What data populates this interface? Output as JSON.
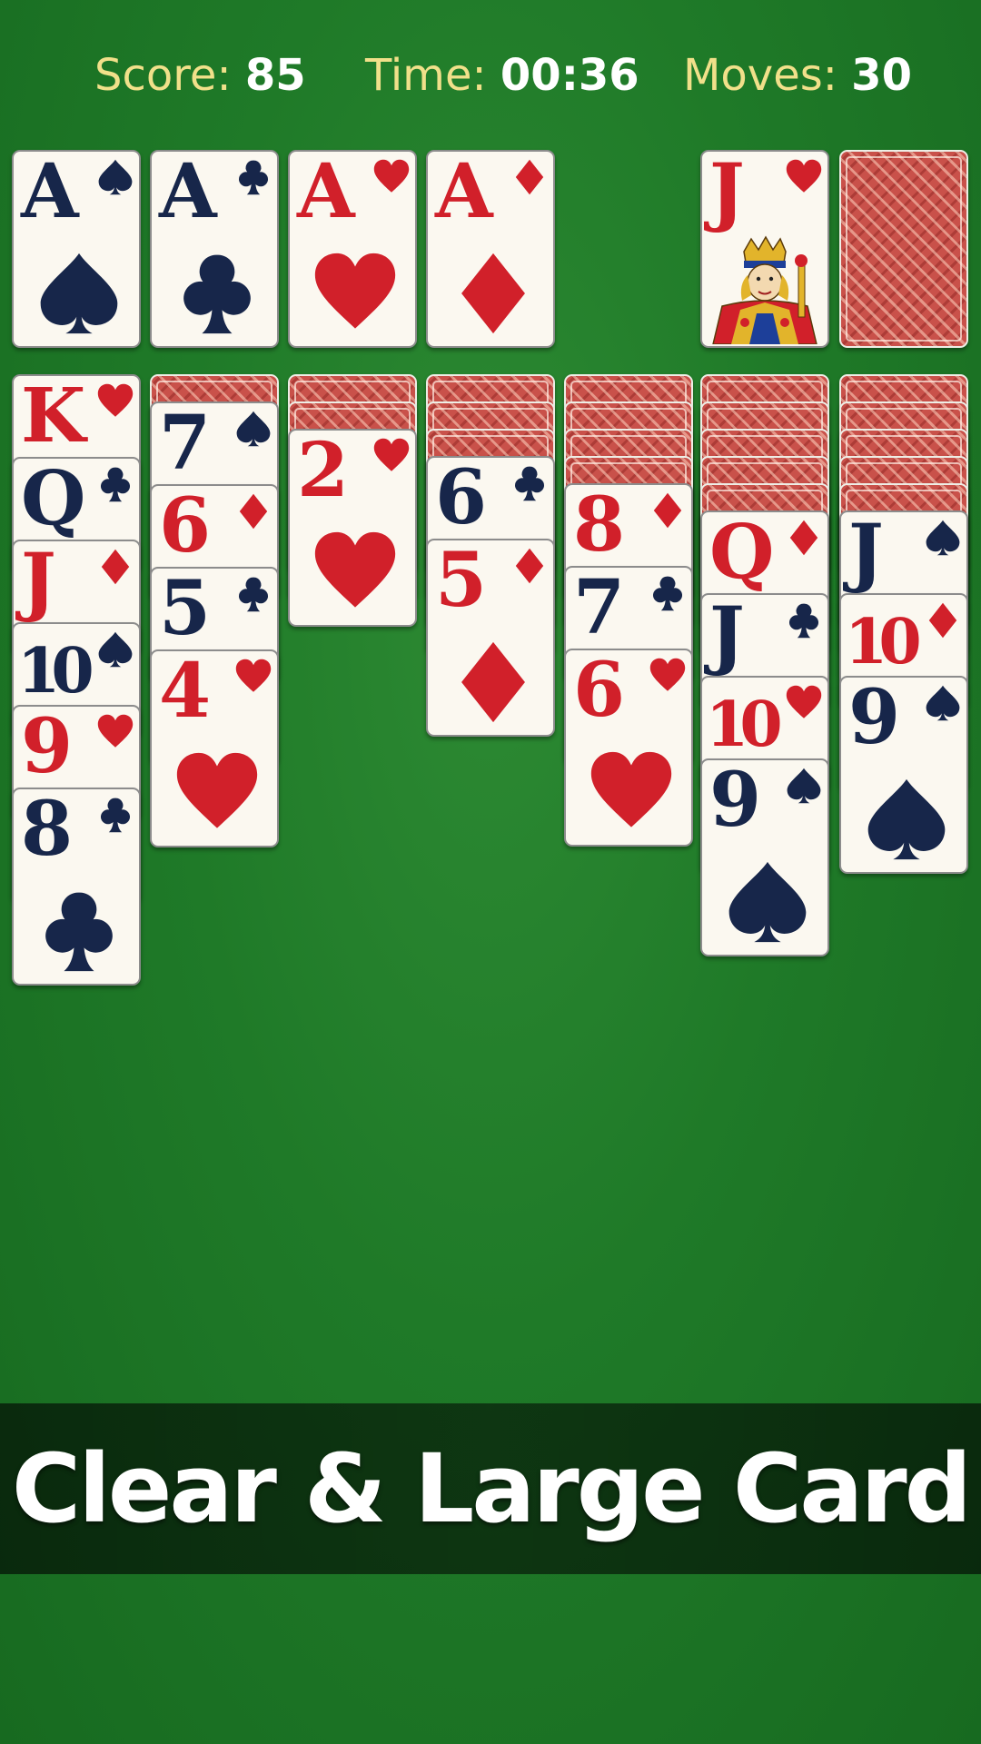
{
  "stats": {
    "score_label": "Score:",
    "score_value": "85",
    "time_label": "Time:",
    "time_value": "00:36",
    "moves_label": "Moves:",
    "moves_value": "30"
  },
  "foundations": [
    {
      "rank": "A",
      "suit": "spades"
    },
    {
      "rank": "A",
      "suit": "clubs"
    },
    {
      "rank": "A",
      "suit": "hearts"
    },
    {
      "rank": "A",
      "suit": "diamonds"
    }
  ],
  "waste": {
    "rank": "J",
    "suit": "hearts",
    "face_icon": "jack-face-icon"
  },
  "stock": {
    "face_down": true
  },
  "tableau": [
    {
      "hidden": 0,
      "cards": [
        {
          "rank": "K",
          "suit": "hearts"
        },
        {
          "rank": "Q",
          "suit": "clubs"
        },
        {
          "rank": "J",
          "suit": "diamonds"
        },
        {
          "rank": "10",
          "suit": "spades"
        },
        {
          "rank": "9",
          "suit": "hearts"
        },
        {
          "rank": "8",
          "suit": "clubs"
        }
      ]
    },
    {
      "hidden": 1,
      "cards": [
        {
          "rank": "7",
          "suit": "spades"
        },
        {
          "rank": "6",
          "suit": "diamonds"
        },
        {
          "rank": "5",
          "suit": "clubs"
        },
        {
          "rank": "4",
          "suit": "hearts"
        }
      ]
    },
    {
      "hidden": 2,
      "cards": [
        {
          "rank": "2",
          "suit": "hearts"
        }
      ]
    },
    {
      "hidden": 3,
      "cards": [
        {
          "rank": "6",
          "suit": "clubs"
        },
        {
          "rank": "5",
          "suit": "diamonds"
        }
      ]
    },
    {
      "hidden": 4,
      "cards": [
        {
          "rank": "8",
          "suit": "diamonds"
        },
        {
          "rank": "7",
          "suit": "clubs"
        },
        {
          "rank": "6",
          "suit": "hearts"
        }
      ]
    },
    {
      "hidden": 5,
      "cards": [
        {
          "rank": "Q",
          "suit": "diamonds"
        },
        {
          "rank": "J",
          "suit": "clubs"
        },
        {
          "rank": "10",
          "suit": "hearts"
        },
        {
          "rank": "9",
          "suit": "spades"
        }
      ]
    },
    {
      "hidden": 5,
      "cards": [
        {
          "rank": "J",
          "suit": "spades"
        },
        {
          "rank": "10",
          "suit": "diamonds"
        },
        {
          "rank": "9",
          "suit": "spades"
        }
      ]
    }
  ],
  "banner": {
    "text": "Clear & Large Card"
  },
  "colors": {
    "felt": "#1f7a28",
    "red_suit": "#d1202a",
    "black_suit": "#17264a",
    "stat_label": "#f1e08a",
    "card_face": "#fbf8f0"
  }
}
